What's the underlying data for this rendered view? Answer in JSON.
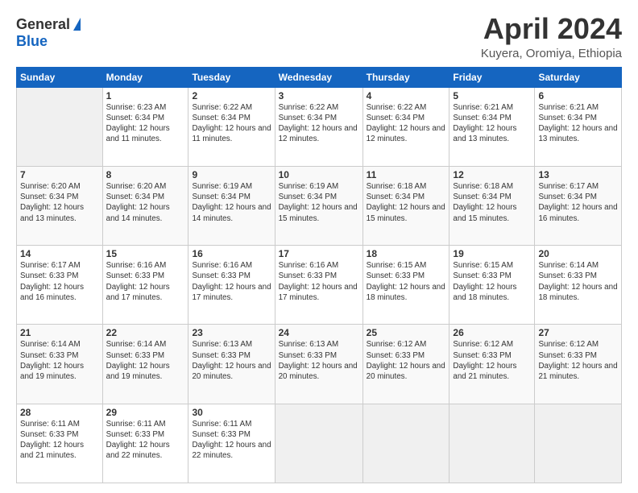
{
  "header": {
    "logo_general": "General",
    "logo_blue": "Blue",
    "title": "April 2024",
    "subtitle": "Kuyera, Oromiya, Ethiopia"
  },
  "days_of_week": [
    "Sunday",
    "Monday",
    "Tuesday",
    "Wednesday",
    "Thursday",
    "Friday",
    "Saturday"
  ],
  "weeks": [
    [
      {
        "num": "",
        "sunrise": "",
        "sunset": "",
        "daylight": ""
      },
      {
        "num": "1",
        "sunrise": "Sunrise: 6:23 AM",
        "sunset": "Sunset: 6:34 PM",
        "daylight": "Daylight: 12 hours and 11 minutes."
      },
      {
        "num": "2",
        "sunrise": "Sunrise: 6:22 AM",
        "sunset": "Sunset: 6:34 PM",
        "daylight": "Daylight: 12 hours and 11 minutes."
      },
      {
        "num": "3",
        "sunrise": "Sunrise: 6:22 AM",
        "sunset": "Sunset: 6:34 PM",
        "daylight": "Daylight: 12 hours and 12 minutes."
      },
      {
        "num": "4",
        "sunrise": "Sunrise: 6:22 AM",
        "sunset": "Sunset: 6:34 PM",
        "daylight": "Daylight: 12 hours and 12 minutes."
      },
      {
        "num": "5",
        "sunrise": "Sunrise: 6:21 AM",
        "sunset": "Sunset: 6:34 PM",
        "daylight": "Daylight: 12 hours and 13 minutes."
      },
      {
        "num": "6",
        "sunrise": "Sunrise: 6:21 AM",
        "sunset": "Sunset: 6:34 PM",
        "daylight": "Daylight: 12 hours and 13 minutes."
      }
    ],
    [
      {
        "num": "7",
        "sunrise": "Sunrise: 6:20 AM",
        "sunset": "Sunset: 6:34 PM",
        "daylight": "Daylight: 12 hours and 13 minutes."
      },
      {
        "num": "8",
        "sunrise": "Sunrise: 6:20 AM",
        "sunset": "Sunset: 6:34 PM",
        "daylight": "Daylight: 12 hours and 14 minutes."
      },
      {
        "num": "9",
        "sunrise": "Sunrise: 6:19 AM",
        "sunset": "Sunset: 6:34 PM",
        "daylight": "Daylight: 12 hours and 14 minutes."
      },
      {
        "num": "10",
        "sunrise": "Sunrise: 6:19 AM",
        "sunset": "Sunset: 6:34 PM",
        "daylight": "Daylight: 12 hours and 15 minutes."
      },
      {
        "num": "11",
        "sunrise": "Sunrise: 6:18 AM",
        "sunset": "Sunset: 6:34 PM",
        "daylight": "Daylight: 12 hours and 15 minutes."
      },
      {
        "num": "12",
        "sunrise": "Sunrise: 6:18 AM",
        "sunset": "Sunset: 6:34 PM",
        "daylight": "Daylight: 12 hours and 15 minutes."
      },
      {
        "num": "13",
        "sunrise": "Sunrise: 6:17 AM",
        "sunset": "Sunset: 6:34 PM",
        "daylight": "Daylight: 12 hours and 16 minutes."
      }
    ],
    [
      {
        "num": "14",
        "sunrise": "Sunrise: 6:17 AM",
        "sunset": "Sunset: 6:33 PM",
        "daylight": "Daylight: 12 hours and 16 minutes."
      },
      {
        "num": "15",
        "sunrise": "Sunrise: 6:16 AM",
        "sunset": "Sunset: 6:33 PM",
        "daylight": "Daylight: 12 hours and 17 minutes."
      },
      {
        "num": "16",
        "sunrise": "Sunrise: 6:16 AM",
        "sunset": "Sunset: 6:33 PM",
        "daylight": "Daylight: 12 hours and 17 minutes."
      },
      {
        "num": "17",
        "sunrise": "Sunrise: 6:16 AM",
        "sunset": "Sunset: 6:33 PM",
        "daylight": "Daylight: 12 hours and 17 minutes."
      },
      {
        "num": "18",
        "sunrise": "Sunrise: 6:15 AM",
        "sunset": "Sunset: 6:33 PM",
        "daylight": "Daylight: 12 hours and 18 minutes."
      },
      {
        "num": "19",
        "sunrise": "Sunrise: 6:15 AM",
        "sunset": "Sunset: 6:33 PM",
        "daylight": "Daylight: 12 hours and 18 minutes."
      },
      {
        "num": "20",
        "sunrise": "Sunrise: 6:14 AM",
        "sunset": "Sunset: 6:33 PM",
        "daylight": "Daylight: 12 hours and 18 minutes."
      }
    ],
    [
      {
        "num": "21",
        "sunrise": "Sunrise: 6:14 AM",
        "sunset": "Sunset: 6:33 PM",
        "daylight": "Daylight: 12 hours and 19 minutes."
      },
      {
        "num": "22",
        "sunrise": "Sunrise: 6:14 AM",
        "sunset": "Sunset: 6:33 PM",
        "daylight": "Daylight: 12 hours and 19 minutes."
      },
      {
        "num": "23",
        "sunrise": "Sunrise: 6:13 AM",
        "sunset": "Sunset: 6:33 PM",
        "daylight": "Daylight: 12 hours and 20 minutes."
      },
      {
        "num": "24",
        "sunrise": "Sunrise: 6:13 AM",
        "sunset": "Sunset: 6:33 PM",
        "daylight": "Daylight: 12 hours and 20 minutes."
      },
      {
        "num": "25",
        "sunrise": "Sunrise: 6:12 AM",
        "sunset": "Sunset: 6:33 PM",
        "daylight": "Daylight: 12 hours and 20 minutes."
      },
      {
        "num": "26",
        "sunrise": "Sunrise: 6:12 AM",
        "sunset": "Sunset: 6:33 PM",
        "daylight": "Daylight: 12 hours and 21 minutes."
      },
      {
        "num": "27",
        "sunrise": "Sunrise: 6:12 AM",
        "sunset": "Sunset: 6:33 PM",
        "daylight": "Daylight: 12 hours and 21 minutes."
      }
    ],
    [
      {
        "num": "28",
        "sunrise": "Sunrise: 6:11 AM",
        "sunset": "Sunset: 6:33 PM",
        "daylight": "Daylight: 12 hours and 21 minutes."
      },
      {
        "num": "29",
        "sunrise": "Sunrise: 6:11 AM",
        "sunset": "Sunset: 6:33 PM",
        "daylight": "Daylight: 12 hours and 22 minutes."
      },
      {
        "num": "30",
        "sunrise": "Sunrise: 6:11 AM",
        "sunset": "Sunset: 6:33 PM",
        "daylight": "Daylight: 12 hours and 22 minutes."
      },
      {
        "num": "",
        "sunrise": "",
        "sunset": "",
        "daylight": ""
      },
      {
        "num": "",
        "sunrise": "",
        "sunset": "",
        "daylight": ""
      },
      {
        "num": "",
        "sunrise": "",
        "sunset": "",
        "daylight": ""
      },
      {
        "num": "",
        "sunrise": "",
        "sunset": "",
        "daylight": ""
      }
    ]
  ]
}
